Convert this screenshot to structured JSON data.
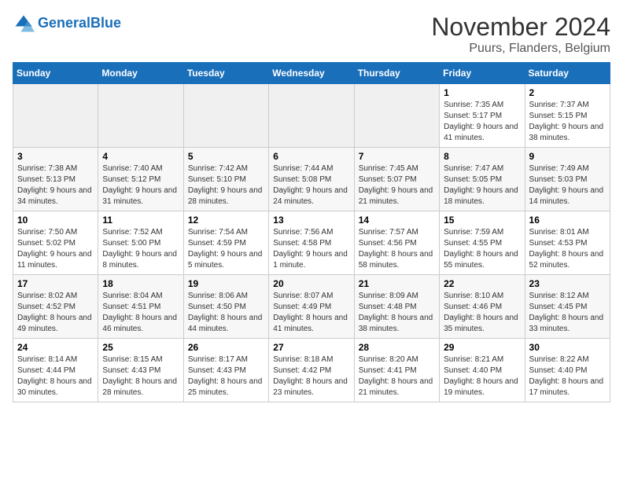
{
  "logo": {
    "text_general": "General",
    "text_blue": "Blue"
  },
  "title": "November 2024",
  "subtitle": "Puurs, Flanders, Belgium",
  "weekdays": [
    "Sunday",
    "Monday",
    "Tuesday",
    "Wednesday",
    "Thursday",
    "Friday",
    "Saturday"
  ],
  "weeks": [
    [
      {
        "day": "",
        "sunrise": "",
        "sunset": "",
        "daylight": ""
      },
      {
        "day": "",
        "sunrise": "",
        "sunset": "",
        "daylight": ""
      },
      {
        "day": "",
        "sunrise": "",
        "sunset": "",
        "daylight": ""
      },
      {
        "day": "",
        "sunrise": "",
        "sunset": "",
        "daylight": ""
      },
      {
        "day": "",
        "sunrise": "",
        "sunset": "",
        "daylight": ""
      },
      {
        "day": "1",
        "sunrise": "Sunrise: 7:35 AM",
        "sunset": "Sunset: 5:17 PM",
        "daylight": "Daylight: 9 hours and 41 minutes."
      },
      {
        "day": "2",
        "sunrise": "Sunrise: 7:37 AM",
        "sunset": "Sunset: 5:15 PM",
        "daylight": "Daylight: 9 hours and 38 minutes."
      }
    ],
    [
      {
        "day": "3",
        "sunrise": "Sunrise: 7:38 AM",
        "sunset": "Sunset: 5:13 PM",
        "daylight": "Daylight: 9 hours and 34 minutes."
      },
      {
        "day": "4",
        "sunrise": "Sunrise: 7:40 AM",
        "sunset": "Sunset: 5:12 PM",
        "daylight": "Daylight: 9 hours and 31 minutes."
      },
      {
        "day": "5",
        "sunrise": "Sunrise: 7:42 AM",
        "sunset": "Sunset: 5:10 PM",
        "daylight": "Daylight: 9 hours and 28 minutes."
      },
      {
        "day": "6",
        "sunrise": "Sunrise: 7:44 AM",
        "sunset": "Sunset: 5:08 PM",
        "daylight": "Daylight: 9 hours and 24 minutes."
      },
      {
        "day": "7",
        "sunrise": "Sunrise: 7:45 AM",
        "sunset": "Sunset: 5:07 PM",
        "daylight": "Daylight: 9 hours and 21 minutes."
      },
      {
        "day": "8",
        "sunrise": "Sunrise: 7:47 AM",
        "sunset": "Sunset: 5:05 PM",
        "daylight": "Daylight: 9 hours and 18 minutes."
      },
      {
        "day": "9",
        "sunrise": "Sunrise: 7:49 AM",
        "sunset": "Sunset: 5:03 PM",
        "daylight": "Daylight: 9 hours and 14 minutes."
      }
    ],
    [
      {
        "day": "10",
        "sunrise": "Sunrise: 7:50 AM",
        "sunset": "Sunset: 5:02 PM",
        "daylight": "Daylight: 9 hours and 11 minutes."
      },
      {
        "day": "11",
        "sunrise": "Sunrise: 7:52 AM",
        "sunset": "Sunset: 5:00 PM",
        "daylight": "Daylight: 9 hours and 8 minutes."
      },
      {
        "day": "12",
        "sunrise": "Sunrise: 7:54 AM",
        "sunset": "Sunset: 4:59 PM",
        "daylight": "Daylight: 9 hours and 5 minutes."
      },
      {
        "day": "13",
        "sunrise": "Sunrise: 7:56 AM",
        "sunset": "Sunset: 4:58 PM",
        "daylight": "Daylight: 9 hours and 1 minute."
      },
      {
        "day": "14",
        "sunrise": "Sunrise: 7:57 AM",
        "sunset": "Sunset: 4:56 PM",
        "daylight": "Daylight: 8 hours and 58 minutes."
      },
      {
        "day": "15",
        "sunrise": "Sunrise: 7:59 AM",
        "sunset": "Sunset: 4:55 PM",
        "daylight": "Daylight: 8 hours and 55 minutes."
      },
      {
        "day": "16",
        "sunrise": "Sunrise: 8:01 AM",
        "sunset": "Sunset: 4:53 PM",
        "daylight": "Daylight: 8 hours and 52 minutes."
      }
    ],
    [
      {
        "day": "17",
        "sunrise": "Sunrise: 8:02 AM",
        "sunset": "Sunset: 4:52 PM",
        "daylight": "Daylight: 8 hours and 49 minutes."
      },
      {
        "day": "18",
        "sunrise": "Sunrise: 8:04 AM",
        "sunset": "Sunset: 4:51 PM",
        "daylight": "Daylight: 8 hours and 46 minutes."
      },
      {
        "day": "19",
        "sunrise": "Sunrise: 8:06 AM",
        "sunset": "Sunset: 4:50 PM",
        "daylight": "Daylight: 8 hours and 44 minutes."
      },
      {
        "day": "20",
        "sunrise": "Sunrise: 8:07 AM",
        "sunset": "Sunset: 4:49 PM",
        "daylight": "Daylight: 8 hours and 41 minutes."
      },
      {
        "day": "21",
        "sunrise": "Sunrise: 8:09 AM",
        "sunset": "Sunset: 4:48 PM",
        "daylight": "Daylight: 8 hours and 38 minutes."
      },
      {
        "day": "22",
        "sunrise": "Sunrise: 8:10 AM",
        "sunset": "Sunset: 4:46 PM",
        "daylight": "Daylight: 8 hours and 35 minutes."
      },
      {
        "day": "23",
        "sunrise": "Sunrise: 8:12 AM",
        "sunset": "Sunset: 4:45 PM",
        "daylight": "Daylight: 8 hours and 33 minutes."
      }
    ],
    [
      {
        "day": "24",
        "sunrise": "Sunrise: 8:14 AM",
        "sunset": "Sunset: 4:44 PM",
        "daylight": "Daylight: 8 hours and 30 minutes."
      },
      {
        "day": "25",
        "sunrise": "Sunrise: 8:15 AM",
        "sunset": "Sunset: 4:43 PM",
        "daylight": "Daylight: 8 hours and 28 minutes."
      },
      {
        "day": "26",
        "sunrise": "Sunrise: 8:17 AM",
        "sunset": "Sunset: 4:43 PM",
        "daylight": "Daylight: 8 hours and 25 minutes."
      },
      {
        "day": "27",
        "sunrise": "Sunrise: 8:18 AM",
        "sunset": "Sunset: 4:42 PM",
        "daylight": "Daylight: 8 hours and 23 minutes."
      },
      {
        "day": "28",
        "sunrise": "Sunrise: 8:20 AM",
        "sunset": "Sunset: 4:41 PM",
        "daylight": "Daylight: 8 hours and 21 minutes."
      },
      {
        "day": "29",
        "sunrise": "Sunrise: 8:21 AM",
        "sunset": "Sunset: 4:40 PM",
        "daylight": "Daylight: 8 hours and 19 minutes."
      },
      {
        "day": "30",
        "sunrise": "Sunrise: 8:22 AM",
        "sunset": "Sunset: 4:40 PM",
        "daylight": "Daylight: 8 hours and 17 minutes."
      }
    ]
  ]
}
